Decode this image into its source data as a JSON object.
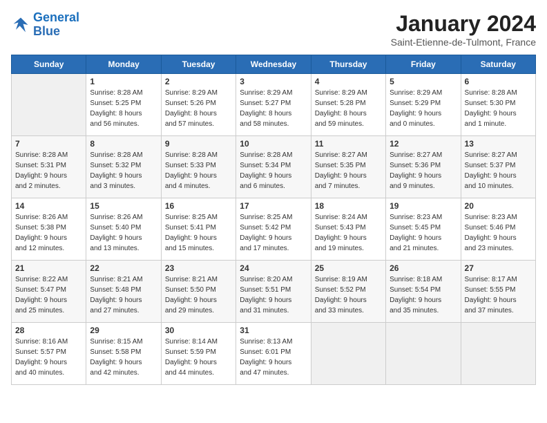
{
  "header": {
    "logo_line1": "General",
    "logo_line2": "Blue",
    "month_year": "January 2024",
    "location": "Saint-Etienne-de-Tulmont, France"
  },
  "days_of_week": [
    "Sunday",
    "Monday",
    "Tuesday",
    "Wednesday",
    "Thursday",
    "Friday",
    "Saturday"
  ],
  "weeks": [
    [
      {
        "day": "",
        "empty": true
      },
      {
        "day": "1",
        "sunrise": "8:28 AM",
        "sunset": "5:25 PM",
        "daylight": "8 hours and 56 minutes."
      },
      {
        "day": "2",
        "sunrise": "8:29 AM",
        "sunset": "5:26 PM",
        "daylight": "8 hours and 57 minutes."
      },
      {
        "day": "3",
        "sunrise": "8:29 AM",
        "sunset": "5:27 PM",
        "daylight": "8 hours and 58 minutes."
      },
      {
        "day": "4",
        "sunrise": "8:29 AM",
        "sunset": "5:28 PM",
        "daylight": "8 hours and 59 minutes."
      },
      {
        "day": "5",
        "sunrise": "8:29 AM",
        "sunset": "5:29 PM",
        "daylight": "9 hours and 0 minutes."
      },
      {
        "day": "6",
        "sunrise": "8:28 AM",
        "sunset": "5:30 PM",
        "daylight": "9 hours and 1 minute."
      }
    ],
    [
      {
        "day": "7",
        "sunrise": "8:28 AM",
        "sunset": "5:31 PM",
        "daylight": "9 hours and 2 minutes."
      },
      {
        "day": "8",
        "sunrise": "8:28 AM",
        "sunset": "5:32 PM",
        "daylight": "9 hours and 3 minutes."
      },
      {
        "day": "9",
        "sunrise": "8:28 AM",
        "sunset": "5:33 PM",
        "daylight": "9 hours and 4 minutes."
      },
      {
        "day": "10",
        "sunrise": "8:28 AM",
        "sunset": "5:34 PM",
        "daylight": "9 hours and 6 minutes."
      },
      {
        "day": "11",
        "sunrise": "8:27 AM",
        "sunset": "5:35 PM",
        "daylight": "9 hours and 7 minutes."
      },
      {
        "day": "12",
        "sunrise": "8:27 AM",
        "sunset": "5:36 PM",
        "daylight": "9 hours and 9 minutes."
      },
      {
        "day": "13",
        "sunrise": "8:27 AM",
        "sunset": "5:37 PM",
        "daylight": "9 hours and 10 minutes."
      }
    ],
    [
      {
        "day": "14",
        "sunrise": "8:26 AM",
        "sunset": "5:38 PM",
        "daylight": "9 hours and 12 minutes."
      },
      {
        "day": "15",
        "sunrise": "8:26 AM",
        "sunset": "5:40 PM",
        "daylight": "9 hours and 13 minutes."
      },
      {
        "day": "16",
        "sunrise": "8:25 AM",
        "sunset": "5:41 PM",
        "daylight": "9 hours and 15 minutes."
      },
      {
        "day": "17",
        "sunrise": "8:25 AM",
        "sunset": "5:42 PM",
        "daylight": "9 hours and 17 minutes."
      },
      {
        "day": "18",
        "sunrise": "8:24 AM",
        "sunset": "5:43 PM",
        "daylight": "9 hours and 19 minutes."
      },
      {
        "day": "19",
        "sunrise": "8:23 AM",
        "sunset": "5:45 PM",
        "daylight": "9 hours and 21 minutes."
      },
      {
        "day": "20",
        "sunrise": "8:23 AM",
        "sunset": "5:46 PM",
        "daylight": "9 hours and 23 minutes."
      }
    ],
    [
      {
        "day": "21",
        "sunrise": "8:22 AM",
        "sunset": "5:47 PM",
        "daylight": "9 hours and 25 minutes."
      },
      {
        "day": "22",
        "sunrise": "8:21 AM",
        "sunset": "5:48 PM",
        "daylight": "9 hours and 27 minutes."
      },
      {
        "day": "23",
        "sunrise": "8:21 AM",
        "sunset": "5:50 PM",
        "daylight": "9 hours and 29 minutes."
      },
      {
        "day": "24",
        "sunrise": "8:20 AM",
        "sunset": "5:51 PM",
        "daylight": "9 hours and 31 minutes."
      },
      {
        "day": "25",
        "sunrise": "8:19 AM",
        "sunset": "5:52 PM",
        "daylight": "9 hours and 33 minutes."
      },
      {
        "day": "26",
        "sunrise": "8:18 AM",
        "sunset": "5:54 PM",
        "daylight": "9 hours and 35 minutes."
      },
      {
        "day": "27",
        "sunrise": "8:17 AM",
        "sunset": "5:55 PM",
        "daylight": "9 hours and 37 minutes."
      }
    ],
    [
      {
        "day": "28",
        "sunrise": "8:16 AM",
        "sunset": "5:57 PM",
        "daylight": "9 hours and 40 minutes."
      },
      {
        "day": "29",
        "sunrise": "8:15 AM",
        "sunset": "5:58 PM",
        "daylight": "9 hours and 42 minutes."
      },
      {
        "day": "30",
        "sunrise": "8:14 AM",
        "sunset": "5:59 PM",
        "daylight": "9 hours and 44 minutes."
      },
      {
        "day": "31",
        "sunrise": "8:13 AM",
        "sunset": "6:01 PM",
        "daylight": "9 hours and 47 minutes."
      },
      {
        "day": "",
        "empty": true
      },
      {
        "day": "",
        "empty": true
      },
      {
        "day": "",
        "empty": true
      }
    ]
  ],
  "labels": {
    "sunrise": "Sunrise:",
    "sunset": "Sunset:",
    "daylight": "Daylight:"
  }
}
